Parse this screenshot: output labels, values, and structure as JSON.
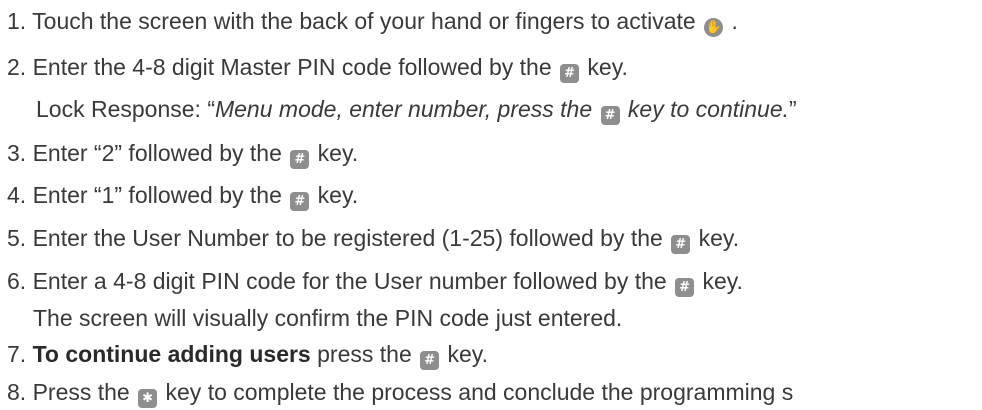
{
  "steps": {
    "s1": {
      "text": "1. Touch the screen with the back of your hand or fingers to activate ",
      "icon": "hand-touch-icon",
      "after": " ."
    },
    "s2": {
      "before": "2. Enter the 4-8 digit Master PIN code followed by the ",
      "after": " key."
    },
    "s2_response": {
      "label": "Lock Response: “",
      "quote_before": "Menu mode, enter number, press the ",
      "quote_after": " key to continue.",
      "close": "”"
    },
    "s3": {
      "before": "3. Enter “2” followed by the ",
      "after": " key."
    },
    "s4": {
      "before": "4. Enter “1” followed by the ",
      "after": " key."
    },
    "s5": {
      "before": "5. Enter the User Number to be registered (1-25) followed by the ",
      "after": " key."
    },
    "s6": {
      "before": "6. Enter a 4-8 digit PIN code for the User number followed by the ",
      "after": " key."
    },
    "s6_note": {
      "text": "The screen will visually confirm the PIN code just entered."
    },
    "s7": {
      "number": "7. ",
      "bold": "To continue adding users",
      "before": " press the ",
      "after": " key."
    },
    "s8": {
      "before": "8. Press the ",
      "after": " key to complete the process and conclude the programming s"
    }
  },
  "keys": {
    "hash_symbol": "#",
    "star_symbol": "✱",
    "hand_symbol": "✋"
  },
  "colors": {
    "text": "#3a3a3a",
    "key_bg": "#8e8e8e",
    "key_fg": "#ffffff"
  }
}
